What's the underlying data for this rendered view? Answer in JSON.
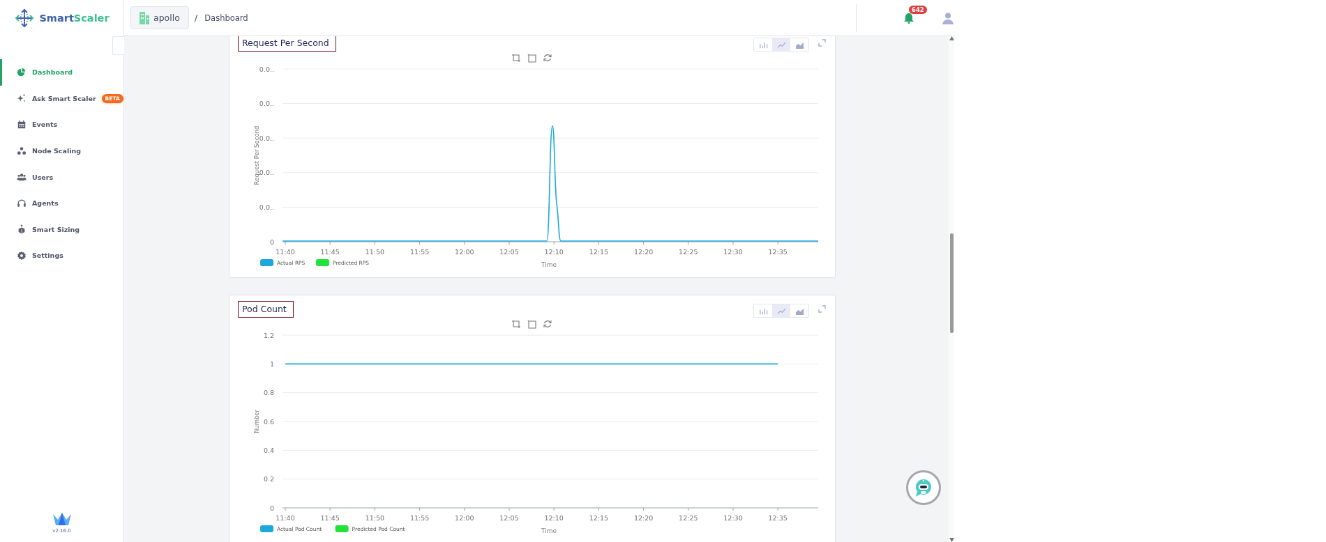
{
  "sidebar": {
    "brand": {
      "part_1": "Smart",
      "part_2": "Scaler"
    },
    "items": [
      {
        "kind": "dashboard",
        "label": "Dashboard",
        "selected": true
      },
      {
        "kind": "sparkle",
        "label": "Ask Smart Scaler",
        "badge": "BETA",
        "selected": false
      },
      {
        "kind": "calendar",
        "label": "Events",
        "selected": false
      },
      {
        "kind": "nodes",
        "label": "Node Scaling",
        "selected": false
      },
      {
        "kind": "users",
        "label": "Users",
        "selected": false
      },
      {
        "kind": "headset",
        "label": "Agents",
        "selected": false
      },
      {
        "kind": "sizing",
        "label": "Smart Sizing",
        "selected": false
      },
      {
        "kind": "settings",
        "label": "Settings",
        "selected": false
      }
    ],
    "version": "v2.16.0"
  },
  "header": {
    "organization": "apollo",
    "separator": "/",
    "page": "Dashboard",
    "notification_count": "642"
  },
  "charts": [
    {
      "title": "Request Per Second",
      "view_toggles": [
        {
          "kind": "bar",
          "selected": false
        },
        {
          "kind": "line",
          "selected": true
        },
        {
          "kind": "area",
          "selected": false
        }
      ],
      "ylabel": "Request Per Second",
      "y_tick_labels": [
        "0.0..",
        "0.0..",
        "0.0..",
        "0.0..",
        "0.0..",
        "0"
      ],
      "x_tick_labels": [
        "11:40",
        "11:45",
        "11:50",
        "11:55",
        "12:00",
        "12:05",
        "12:10",
        "12:15",
        "12:20",
        "12:25",
        "12:30",
        "12:35"
      ],
      "xlabel": "Time",
      "legend": [
        {
          "label": "Actual RPS",
          "color": "#1ca8dd"
        },
        {
          "label": "Predicted RPS",
          "color": "#22e33a"
        }
      ]
    },
    {
      "view_toggles": [
        {
          "kind": "bar",
          "selected": false
        },
        {
          "kind": "line",
          "selected": true
        },
        {
          "kind": "area",
          "selected": false
        }
      ],
      "chart_data": {
        "type": "line",
        "grid": true,
        "title": "Pod Count",
        "xlabel": "Time",
        "ylabel": "Number",
        "categories": [
          "11:40",
          "11:45",
          "11:50",
          "11:55",
          "12:00",
          "12:05",
          "12:10",
          "12:15",
          "12:20",
          "12:25",
          "12:30",
          "12:35"
        ],
        "ylim": [
          0,
          1.2
        ],
        "yticks": [
          0,
          0.2,
          0.4,
          0.6,
          0.8,
          1,
          1.2
        ],
        "series": [
          {
            "name": "Actual Pod Count",
            "color": "#1ca8dd",
            "values": [
              1,
              1,
              1,
              1,
              1,
              1,
              1,
              1,
              1,
              1,
              1,
              1
            ]
          },
          {
            "name": "Predicted Pod Count",
            "color": "#22e33a",
            "values": [
              null,
              null,
              null,
              null,
              null,
              null,
              null,
              null,
              null,
              null,
              null,
              null
            ]
          }
        ]
      }
    }
  ]
}
